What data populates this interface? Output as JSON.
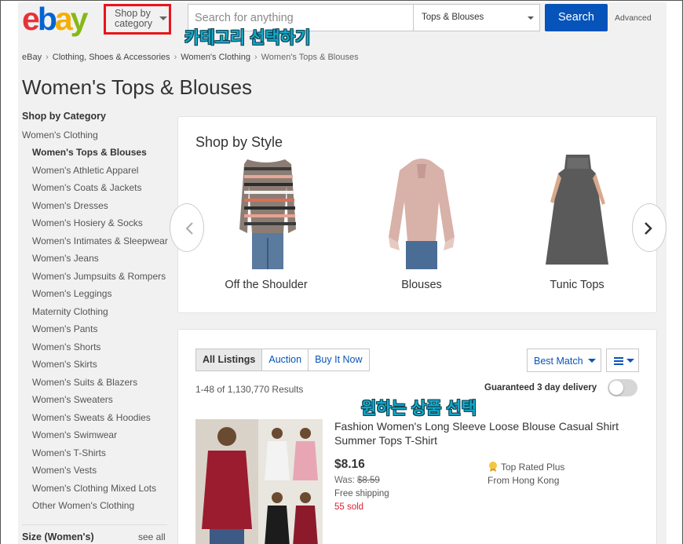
{
  "header": {
    "logo": [
      "e",
      "b",
      "a",
      "y"
    ],
    "shop_by_category_line1": "Shop by",
    "shop_by_category_line2": "category",
    "search_placeholder": "Search for anything",
    "category_select": "Tops & Blouses",
    "search_button": "Search",
    "advanced": "Advanced"
  },
  "annotations": {
    "select_category": "카테고리 선택하기",
    "select_product": "원하는 상품 선택"
  },
  "breadcrumb": [
    "eBay",
    "Clothing, Shoes & Accessories",
    "Women's Clothing",
    "Women's Tops & Blouses"
  ],
  "page_title": "Women's Tops & Blouses",
  "sidebar": {
    "heading": "Shop by Category",
    "parent": "Women's Clothing",
    "items": [
      "Women's Tops & Blouses",
      "Women's Athletic Apparel",
      "Women's Coats & Jackets",
      "Women's Dresses",
      "Women's Hosiery & Socks",
      "Women's Intimates & Sleepwear",
      "Women's Jeans",
      "Women's Jumpsuits & Rompers",
      "Women's Leggings",
      "Maternity Clothing",
      "Women's Pants",
      "Women's Shorts",
      "Women's Skirts",
      "Women's Suits & Blazers",
      "Women's Sweaters",
      "Women's Sweats & Hoodies",
      "Women's Swimwear",
      "Women's T-Shirts",
      "Women's Vests",
      "Women's Clothing Mixed Lots",
      "Other Women's Clothing"
    ],
    "size_heading": "Size (Women's)",
    "see_all": "see all"
  },
  "shop_by_style": {
    "title": "Shop by Style",
    "items": [
      "Off the Shoulder",
      "Blouses",
      "Tunic Tops"
    ]
  },
  "listings": {
    "tabs": [
      "All Listings",
      "Auction",
      "Buy It Now"
    ],
    "sort": "Best Match",
    "results": "1-48 of 1,130,770 Results",
    "guaranteed": "Guaranteed 3 day delivery",
    "item": {
      "title": "Fashion Women's Long Sleeve Loose Blouse Casual Shirt Summer Tops T-Shirt",
      "price": "$8.16",
      "was_label": "Was:",
      "was_price": "$8.59",
      "shipping": "Free shipping",
      "sold": "55 sold",
      "badge": "Top Rated Plus",
      "from": "From Hong Kong"
    }
  },
  "colors": {
    "brand_red": "#e53238",
    "brand_blue": "#0064d2",
    "brand_yellow": "#f5af02",
    "brand_green": "#86b817",
    "search_blue": "#0654ba",
    "annotation_teal": "#14a8c9",
    "highlight_red": "#e8141c"
  }
}
